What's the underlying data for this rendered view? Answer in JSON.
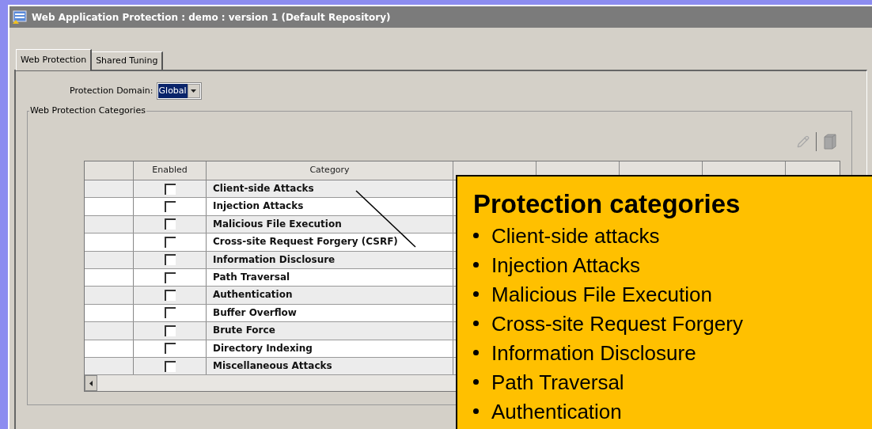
{
  "window": {
    "title": "Web Application Protection : demo : version 1 (Default Repository)"
  },
  "tabs": [
    {
      "label": "Web Protection",
      "selected": true
    },
    {
      "label": "Shared Tuning",
      "selected": false
    }
  ],
  "protection_domain": {
    "label": "Protection Domain:",
    "value": "Global"
  },
  "group": {
    "title": "Web Protection Categories"
  },
  "table": {
    "columns": [
      "Enabled",
      "Category"
    ],
    "rows": [
      {
        "enabled": false,
        "category": "Client-side Attacks"
      },
      {
        "enabled": false,
        "category": "Injection Attacks"
      },
      {
        "enabled": false,
        "category": "Malicious File Execution"
      },
      {
        "enabled": false,
        "category": "Cross-site Request Forgery (CSRF)"
      },
      {
        "enabled": false,
        "category": "Information Disclosure"
      },
      {
        "enabled": false,
        "category": "Path Traversal"
      },
      {
        "enabled": false,
        "category": "Authentication"
      },
      {
        "enabled": false,
        "category": "Buffer Overflow"
      },
      {
        "enabled": false,
        "category": "Brute Force"
      },
      {
        "enabled": false,
        "category": "Directory Indexing"
      },
      {
        "enabled": false,
        "category": "Miscellaneous Attacks"
      }
    ]
  },
  "callout": {
    "title": "Protection categories",
    "items": [
      "Client-side attacks",
      "Injection Attacks",
      "Malicious File Execution",
      "Cross-site Request Forgery",
      "Information Disclosure",
      "Path Traversal",
      "Authentication"
    ]
  }
}
